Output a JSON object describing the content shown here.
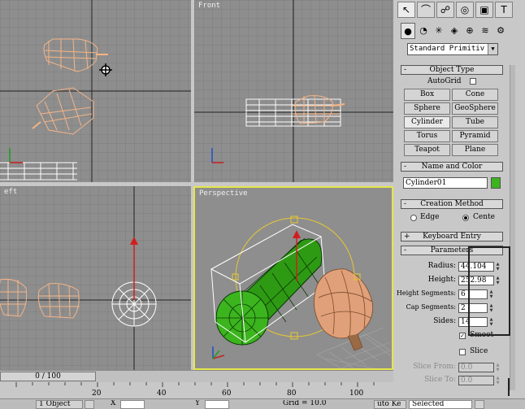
{
  "viewports": {
    "top": {
      "label": ""
    },
    "front": {
      "label": "Front"
    },
    "left": {
      "label": "eft"
    },
    "perspective": {
      "label": "Perspective"
    }
  },
  "command_panel": {
    "tabs": [
      {
        "icon": "cursor-icon"
      },
      {
        "icon": "modify-arc-icon"
      },
      {
        "icon": "hierarchy-icon"
      },
      {
        "icon": "motion-icon"
      },
      {
        "icon": "display-icon"
      },
      {
        "icon": "utilities-hammer-icon"
      }
    ],
    "subtabs": [
      {
        "icon": "geometry-sphere-icon"
      },
      {
        "icon": "shapes-icon"
      },
      {
        "icon": "lights-icon"
      },
      {
        "icon": "cameras-icon"
      },
      {
        "icon": "helpers-icon"
      },
      {
        "icon": "spacewarps-icon"
      },
      {
        "icon": "systems-icon"
      }
    ],
    "category_dropdown": "Standard Primitiv",
    "object_type": {
      "title": "Object Type",
      "autogrid_label": "AutoGrid",
      "buttons": [
        "Box",
        "Cone",
        "Sphere",
        "GeoSphere",
        "Cylinder",
        "Tube",
        "Torus",
        "Pyramid",
        "Teapot",
        "Plane"
      ]
    },
    "name_and_color": {
      "title": "Name and Color",
      "name_value": "Cylinder01",
      "color": "#3cb41e"
    },
    "creation_method": {
      "title": "Creation Method",
      "option_edge": "Edge",
      "option_center": "Cente"
    },
    "keyboard_entry": {
      "title": "Keyboard Entry"
    },
    "parameters": {
      "title": "Parameters",
      "radius_label": "Radius:",
      "radius_value": "44.104",
      "height_label": "Height:",
      "height_value": "252.98",
      "height_segments_label": "Height Segments:",
      "height_segments_value": "6",
      "cap_segments_label": "Cap Segments:",
      "cap_segments_value": "2",
      "sides_label": "Sides:",
      "sides_value": "14",
      "smooth_label": "Smoot",
      "slice_on_label": "Slice",
      "slice_from_label": "Slice From:",
      "slice_from_value": "0.0",
      "slice_to_label": "Slice To:",
      "slice_to_value": "0.0"
    }
  },
  "timeline": {
    "frame_counter": "0 / 100",
    "ruler_ticks": [
      "20",
      "40",
      "60",
      "80",
      "100"
    ]
  },
  "status_bar": {
    "selection": "1 Object",
    "grid": "Grid = 10.0",
    "autokey": "uto Ke",
    "selected": "Selected",
    "x_label": "X",
    "y_label": "Y"
  },
  "colors": {
    "viewport_bg": "#8e8e8e",
    "active_border": "#e6e64a",
    "object_orange": "#f0a878",
    "cylinder_green": "#3cb41e"
  }
}
